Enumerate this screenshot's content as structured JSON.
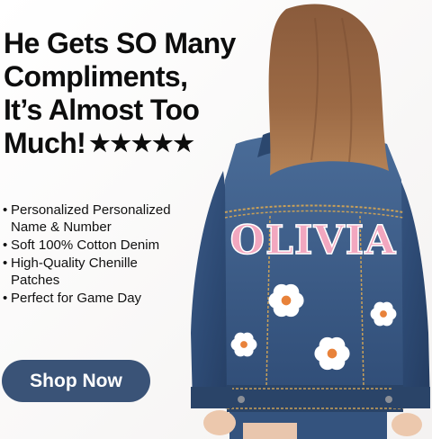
{
  "headline": {
    "lines": [
      "He Gets SO Many",
      "Compliments,",
      "It’s Almost Too",
      "Much!"
    ],
    "stars": "★★★★★",
    "rating_stars": 5
  },
  "bullets": [
    "Personalized Personalized Name & Number",
    "Soft 100% Cotton Denim",
    "High-Quality Chenille Patches",
    "Perfect for Game Day"
  ],
  "bullet_glyph": "•",
  "cta": {
    "label": "Shop Now",
    "color": "#3a5377"
  },
  "product": {
    "patch_name": "OLIVIA",
    "patch_color": "#f2a7bf",
    "denim_color": "#2f4a72",
    "flower_color": "#ffffff",
    "flower_center_color": "#e8823a"
  }
}
